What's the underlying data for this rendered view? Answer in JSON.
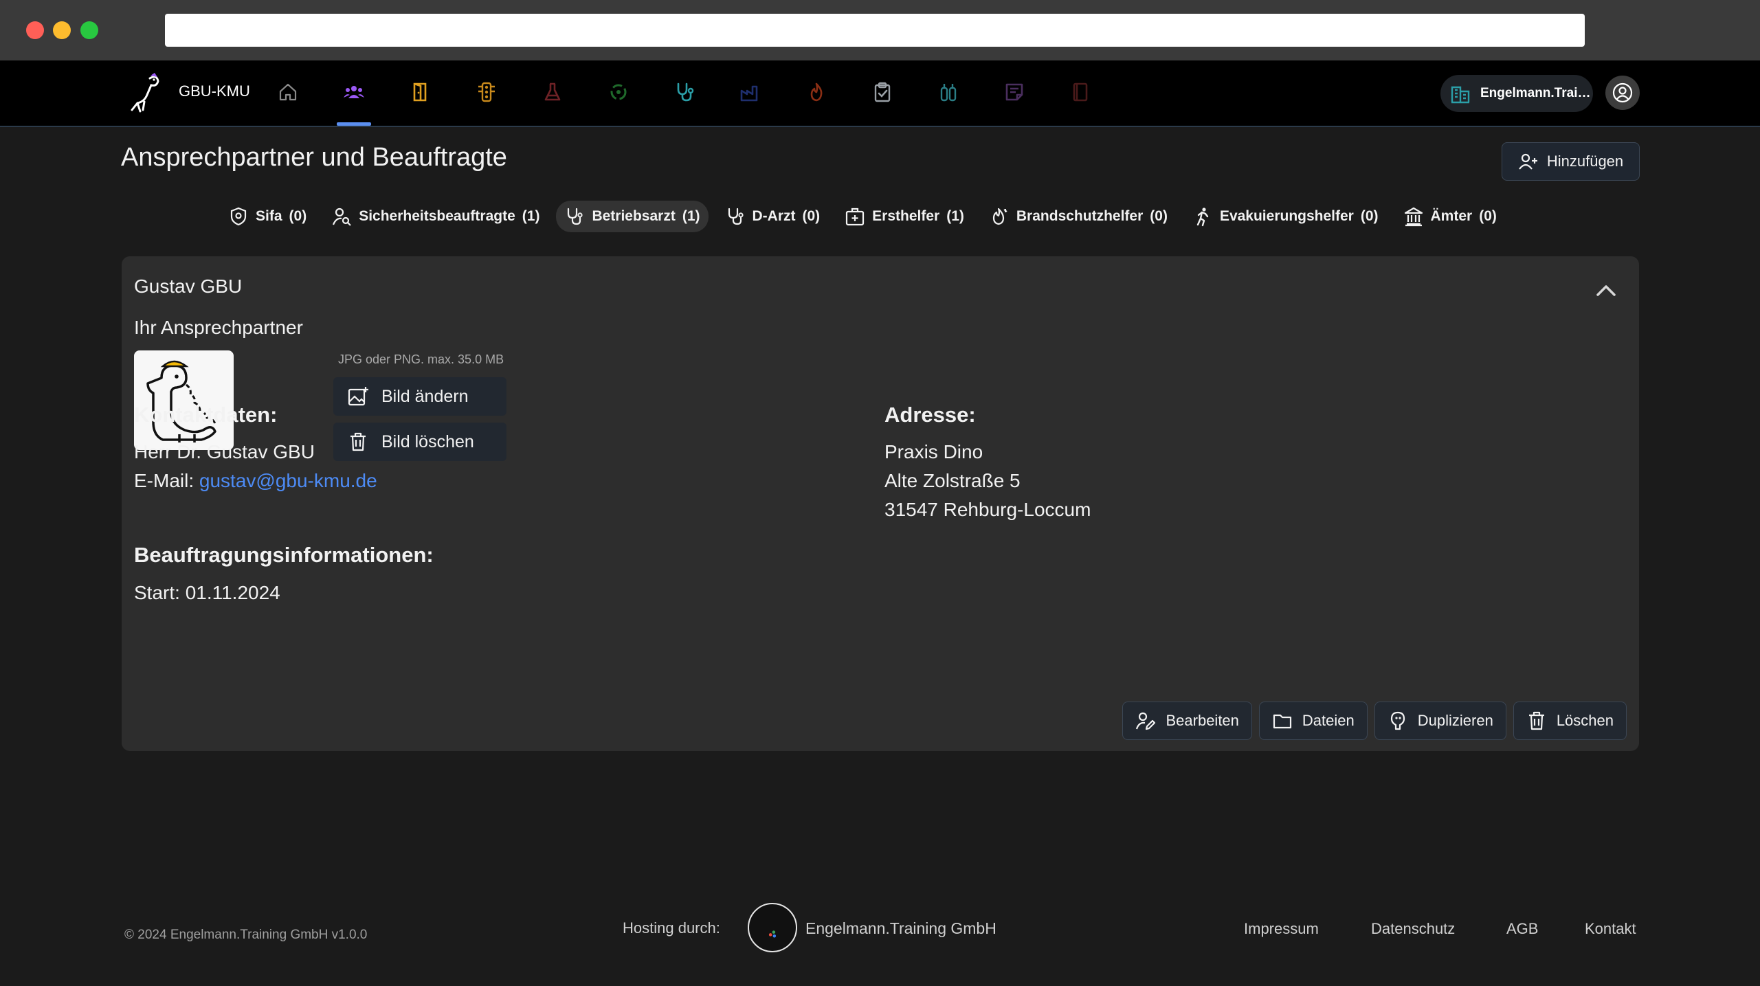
{
  "app": {
    "brand_name": "GBU-KMU",
    "nav_icons": [
      "home-icon",
      "people-icon",
      "door-icon",
      "traffic-light-icon",
      "flask-icon",
      "biohazard-icon",
      "stethoscope-icon",
      "factory-icon",
      "flame-icon",
      "clipboard-check-icon",
      "gas-cylinder-icon",
      "note-icon",
      "book-icon"
    ],
    "active_nav": "people-icon",
    "tenant_label": "Engelmann.Trai…",
    "colors": {
      "accent": "#5b8ff0",
      "people": "#9b59f5",
      "door": "#e0a020",
      "traffic": "#c98a1c",
      "flask": "#6e2226",
      "biohazard": "#1f6a2b",
      "stethoscope": "#2b9fa8",
      "factory": "#1f2f6e",
      "flame": "#8a2e14",
      "clipboard": "#9aa0a6",
      "cylinder": "#2b7e86",
      "note": "#4a2e5e",
      "book": "#4a1a1a",
      "link": "#4d8bf5"
    }
  },
  "page": {
    "title": "Ansprechpartner und Beauftragte",
    "add_button": "Hinzufügen"
  },
  "tabs": [
    {
      "label": "Sifa",
      "count": "(0)",
      "icon": "shield-icon"
    },
    {
      "label": "Sicherheitsbeauftragte",
      "count": "(1)",
      "icon": "user-search-icon"
    },
    {
      "label": "Betriebsarzt",
      "count": "(1)",
      "icon": "stethoscope-icon",
      "active": true
    },
    {
      "label": "D-Arzt",
      "count": "(0)",
      "icon": "stethoscope-icon"
    },
    {
      "label": "Ersthelfer",
      "count": "(1)",
      "icon": "first-aid-icon"
    },
    {
      "label": "Brandschutzhelfer",
      "count": "(0)",
      "icon": "fire-icon"
    },
    {
      "label": "Evakuierungshelfer",
      "count": "(0)",
      "icon": "running-person-icon"
    },
    {
      "label": "Ämter",
      "count": "(0)",
      "icon": "building-columns-icon"
    }
  ],
  "contact": {
    "name": "Gustav GBU",
    "subheading": "Ihr Ansprechpartner",
    "file_hint": "JPG oder PNG. max. 35.0 MB",
    "change_image": "Bild ändern",
    "delete_image": "Bild löschen",
    "contact_heading": "Kontaktdaten:",
    "full_name": "Herr Dr. Gustav GBU",
    "email_label": "E-Mail:",
    "email": "gustav@gbu-kmu.de",
    "address_heading": "Adresse:",
    "address_line1": "Praxis Dino",
    "address_line2": "Alte Zolstraße 5",
    "address_line3": "31547 Rehburg-Loccum",
    "assignment_heading": "Beauftragungsinformationen:",
    "start": "Start: 01.11.2024",
    "actions": {
      "edit": "Bearbeiten",
      "files": "Dateien",
      "duplicate": "Duplizieren",
      "delete": "Löschen"
    }
  },
  "footer": {
    "copyright": "© 2024 Engelmann.Training GmbH v1.0.0",
    "hosting_label": "Hosting durch:",
    "hosting_name": "Engelmann.Training GmbH",
    "links": [
      "Impressum",
      "Datenschutz",
      "AGB",
      "Kontakt"
    ]
  }
}
